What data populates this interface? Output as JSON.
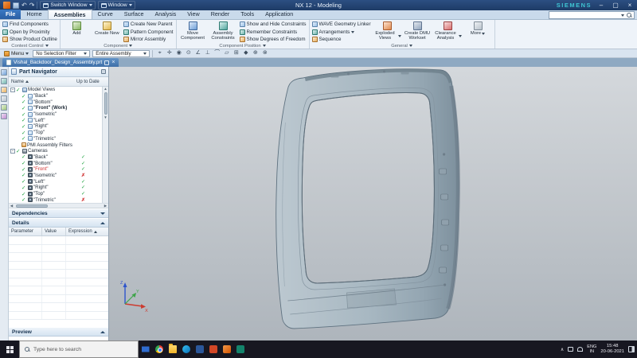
{
  "titlebar": {
    "title": "NX 12 - Modeling",
    "brand": "SIEMENS",
    "switch_window_label": "Switch Window",
    "window_label": "Window"
  },
  "ribbon_tabs": {
    "items": [
      "File",
      "Home",
      "Assemblies",
      "Curve",
      "Surface",
      "Analysis",
      "View",
      "Render",
      "Tools",
      "Application"
    ],
    "active": "Assemblies"
  },
  "command_finder": {
    "value": ""
  },
  "ribbon": {
    "context_control": {
      "label": "Context Control",
      "items": [
        "Find Components",
        "Open by Proximity",
        "Show Product Outline"
      ]
    },
    "component": {
      "label": "Component",
      "add": "Add",
      "create_new": "Create New",
      "items": [
        "Create New Parent",
        "Pattern Component",
        "Mirror Assembly"
      ]
    },
    "component_position": {
      "label": "Component Position",
      "move_component": "Move Component",
      "assembly_constraints": "Assembly Constraints",
      "items": [
        "Show and Hide Constraints",
        "Remember Constraints",
        "Show Degrees of Freedom"
      ]
    },
    "general": {
      "label": "General",
      "items": [
        "WAVE Geometry Linker",
        "Arrangements",
        "Sequence"
      ],
      "exploded_views": "Exploded Views",
      "create_dmu": "Create DMU Workset",
      "clearance_analysis": "Clearance Analysis",
      "more": "More"
    }
  },
  "toolbar": {
    "menu": "Menu",
    "selection_filter": "No Selection Filter",
    "scope": "Entire Assembly",
    "icons": [
      {
        "name": "select-icon",
        "glyph": "⌖"
      },
      {
        "name": "snap-point-icon",
        "glyph": "✛"
      },
      {
        "name": "endpoint-icon",
        "glyph": "◉"
      },
      {
        "name": "midpoint-icon",
        "glyph": "⊙"
      },
      {
        "name": "angle-icon",
        "glyph": "∠"
      },
      {
        "name": "perpendicular-icon",
        "glyph": "⊥"
      },
      {
        "name": "arc-center-icon",
        "glyph": "⌒"
      },
      {
        "name": "plane-icon",
        "glyph": "▱"
      },
      {
        "name": "grid-icon",
        "glyph": "⊞"
      },
      {
        "name": "point-icon",
        "glyph": "◆"
      },
      {
        "name": "intersection-icon",
        "glyph": "⊕"
      },
      {
        "name": "quadrant-icon",
        "glyph": "⊗"
      }
    ]
  },
  "document_tab": {
    "title": "Vishal_Backdoor_Design_Assembly.prt"
  },
  "resource_bar": {
    "icons": [
      "assembly-navigator-icon",
      "constraint-navigator-icon",
      "part-navigator-icon",
      "reuse-library-icon",
      "view-manager-icon",
      "history-icon"
    ]
  },
  "part_navigator": {
    "title": "Part Navigator",
    "columns": {
      "name": "Name",
      "up_to_date": "Up to Date"
    },
    "model_views": {
      "label": "Model Views",
      "items": [
        {
          "label": "\"Back\""
        },
        {
          "label": "\"Bottom\""
        },
        {
          "label": "\"Front\" (Work)",
          "work": true
        },
        {
          "label": "\"Isometric\""
        },
        {
          "label": "\"Left\""
        },
        {
          "label": "\"Right\""
        },
        {
          "label": "\"Top\""
        },
        {
          "label": "\"Trimetric\""
        }
      ]
    },
    "pmi_filters_label": "PMI Assembly Filters",
    "cameras": {
      "label": "Cameras",
      "items": [
        {
          "label": "\"Back\"",
          "up_to_date": true
        },
        {
          "label": "\"Bottom\"",
          "up_to_date": true
        },
        {
          "label": "\"Front\"",
          "up_to_date": true,
          "highlight": true
        },
        {
          "label": "\"Isometric\"",
          "up_to_date": false
        },
        {
          "label": "\"Left\"",
          "up_to_date": true
        },
        {
          "label": "\"Right\"",
          "up_to_date": true
        },
        {
          "label": "\"Top\"",
          "up_to_date": true
        },
        {
          "label": "\"Trimetric\"",
          "up_to_date": false
        }
      ]
    },
    "sections": {
      "dependencies": "Dependencies",
      "details": "Details",
      "preview": "Preview"
    },
    "details_columns": [
      "Parameter",
      "Value",
      "Expression"
    ]
  },
  "viewport": {
    "triad": {
      "x": "X",
      "y": "Y",
      "z": "Z"
    }
  },
  "taskbar": {
    "search_placeholder": "Type here to search",
    "apps": [
      {
        "name": "mail-icon",
        "style": "ic-mail"
      },
      {
        "name": "chrome-icon",
        "style": "ic-chrome"
      },
      {
        "name": "file-explorer-icon",
        "style": "ic-folder"
      },
      {
        "name": "edge-icon",
        "style": "ic-edge"
      },
      {
        "name": "word-icon",
        "style": "ic-word"
      },
      {
        "name": "powerpoint-icon",
        "style": "ic-ppt"
      },
      {
        "name": "nx-app-icon",
        "style": "ic-nx"
      },
      {
        "name": "teams-icon",
        "style": "ic-teal"
      }
    ],
    "tray": {
      "language": "ENG",
      "region": "IN",
      "time": "15:48",
      "date": "20-06-2021"
    }
  }
}
